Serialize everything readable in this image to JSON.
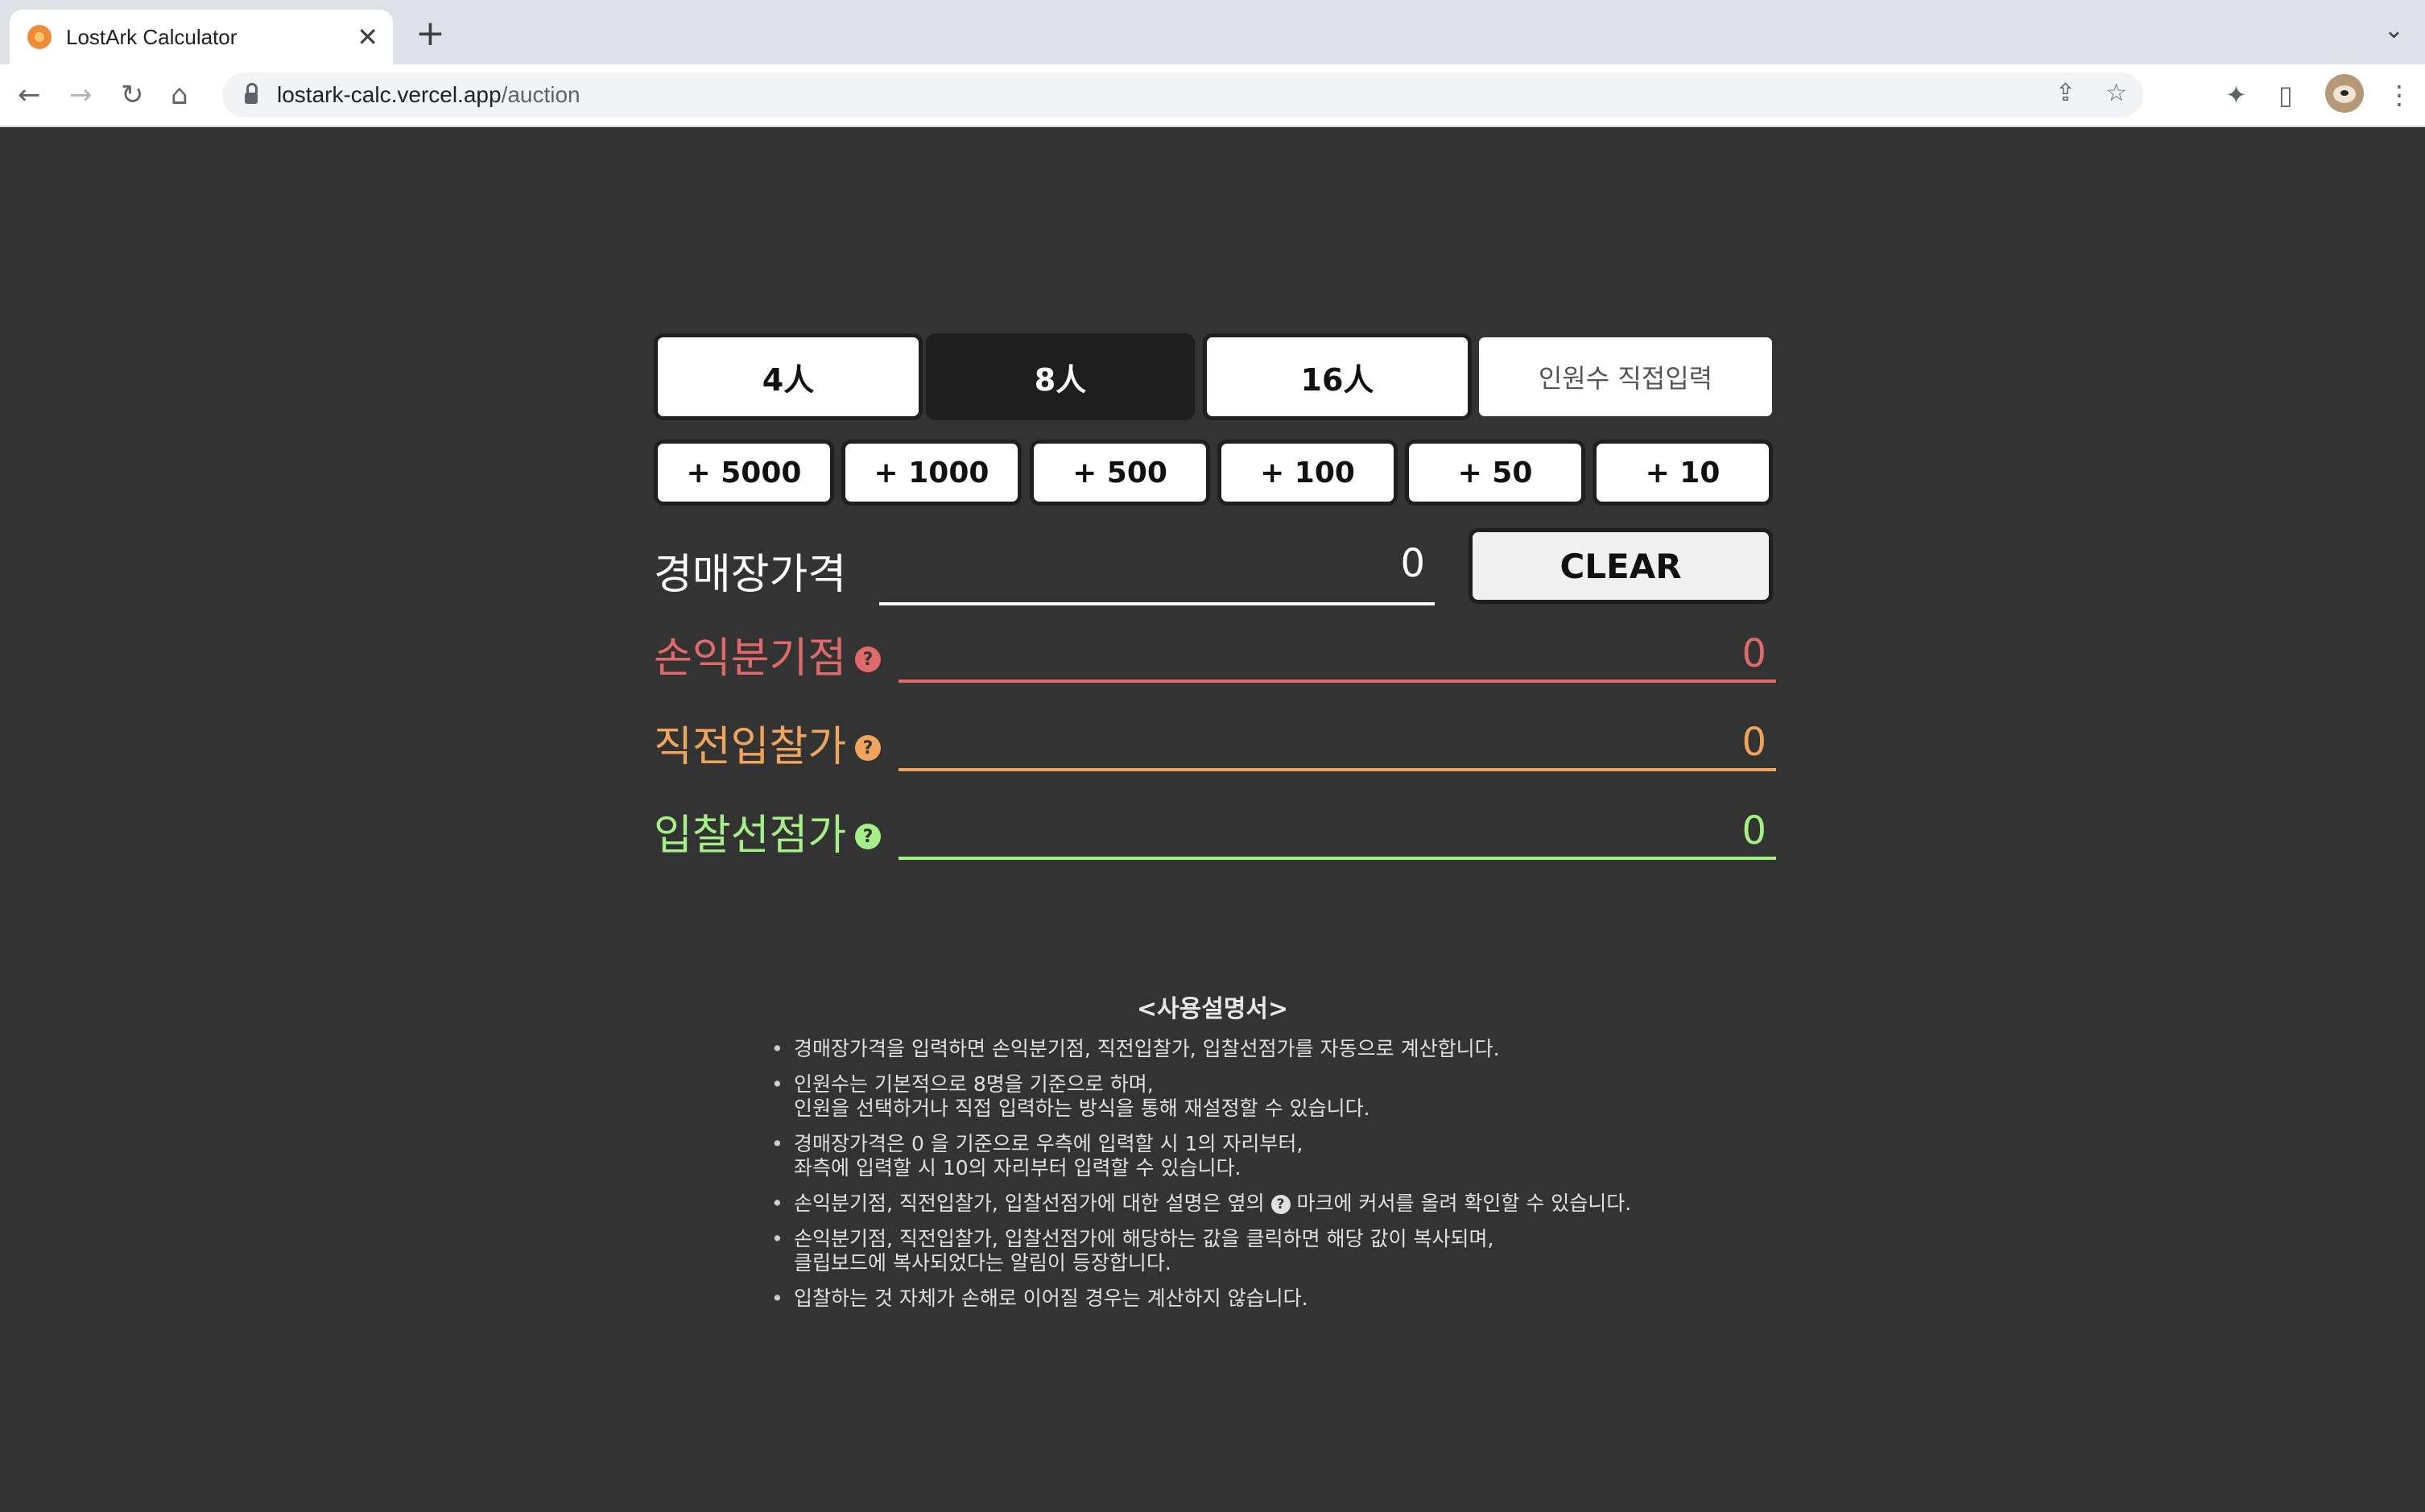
{
  "browser": {
    "tab_title": "LostArk Calculator",
    "url_host": "lostark-calc.vercel.app",
    "url_path": "/auction"
  },
  "people_buttons": [
    {
      "label": "4人",
      "active": false
    },
    {
      "label": "8人",
      "active": true
    },
    {
      "label": "16人",
      "active": false
    },
    {
      "label": "인원수 직접입력",
      "active": false
    }
  ],
  "amount_buttons": [
    "+ 5000",
    "+ 1000",
    "+ 500",
    "+ 100",
    "+ 50",
    "+ 10"
  ],
  "auction_price": {
    "label": "경매장가격",
    "value": "0"
  },
  "clear_label": "CLEAR",
  "results": [
    {
      "label": "손익분기점",
      "value": "0",
      "color": "#e06a6a"
    },
    {
      "label": "직전입찰가",
      "value": "0",
      "color": "#f0a55e"
    },
    {
      "label": "입찰선점가",
      "value": "0",
      "color": "#a6ee88"
    }
  ],
  "help_glyph": "?",
  "manual": {
    "title": "<사용설명서>",
    "items": [
      [
        "경매장가격을 입력하면 손익분기점, 직전입찰가, 입찰선점가를 자동으로 계산합니다."
      ],
      [
        "인원수는 기본적으로 8명을 기준으로 하며,",
        "인원을 선택하거나 직접 입력하는 방식을 통해 재설정할 수 있습니다."
      ],
      [
        "경매장가격은 0 을 기준으로 우측에 입력할 시 1의 자리부터,",
        "좌측에 입력할 시 10의 자리부터 입력할 수 있습니다."
      ],
      [
        "손익분기점, 직전입찰가, 입찰선점가에 대한 설명은 옆의",
        "마크에 커서를 올려 확인할 수 있습니다."
      ],
      [
        "손익분기점, 직전입찰가, 입찰선점가에 해당하는 값을 클릭하면 해당 값이 복사되며,",
        "클립보드에 복사되었다는 알림이 등장합니다."
      ],
      [
        "입찰하는 것 자체가 손해로 이어질 경우는 계산하지 않습니다."
      ]
    ]
  },
  "icons": [
    "favicon-icon",
    "close-icon",
    "plus-icon",
    "back-icon",
    "forward-icon",
    "reload-icon",
    "home-icon",
    "lock-icon",
    "share-icon",
    "star-icon",
    "extensions-icon",
    "sidepanel-icon",
    "avatar",
    "menu-icon",
    "help-icon"
  ]
}
